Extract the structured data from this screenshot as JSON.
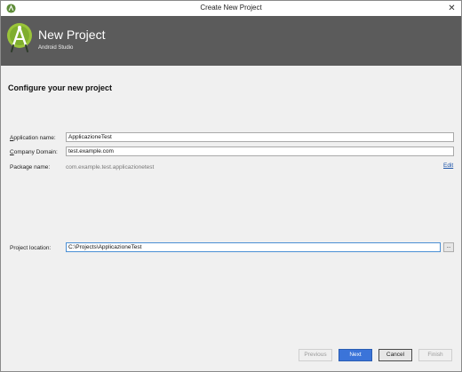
{
  "window": {
    "title": "Create New Project",
    "close_glyph": "✕"
  },
  "banner": {
    "title": "New Project",
    "subtitle": "Android Studio",
    "logo_icon": "android-studio-logo-icon",
    "background": "#5b5b5b"
  },
  "form": {
    "section_title": "Configure your new project",
    "application_name": {
      "label_underlined": "A",
      "label_rest": "pplication name:",
      "value": "ApplicazioneTest"
    },
    "company_domain": {
      "label_underlined": "C",
      "label_rest": "ompany Domain:",
      "value": "test.example.com"
    },
    "package_name": {
      "label": "Package name:",
      "value": "com.example.test.applicazionetest",
      "edit_label": "Edit"
    },
    "project_location": {
      "label": "Project location:",
      "value": "C:\\Projects\\ApplicazioneTest",
      "browse_label": "..."
    }
  },
  "buttons": {
    "previous": "Previous",
    "next": "Next",
    "cancel": "Cancel",
    "finish": "Finish"
  },
  "colors": {
    "accent": "#3b74d9",
    "link": "#1a52a8",
    "android_green": "#a4c639"
  }
}
